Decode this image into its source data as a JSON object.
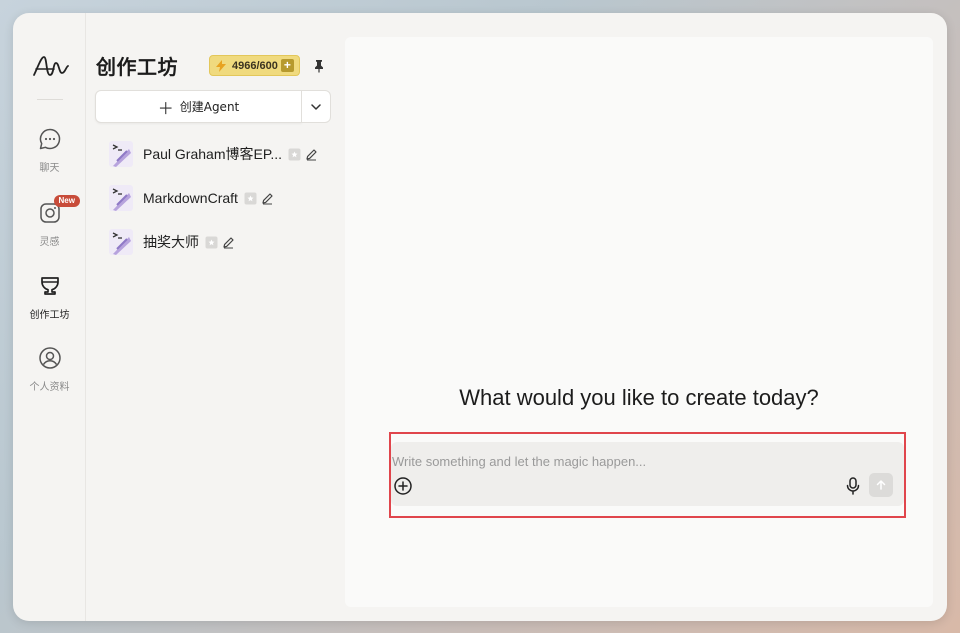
{
  "rail": {
    "items": [
      {
        "label": "聊天",
        "icon": "chat-icon"
      },
      {
        "label": "灵感",
        "icon": "camera-icon",
        "badge": "New"
      },
      {
        "label": "创作工坊",
        "icon": "trophy-icon",
        "active": true
      },
      {
        "label": "个人资料",
        "icon": "user-icon"
      }
    ]
  },
  "sidebar": {
    "title": "创作工坊",
    "credits": "4966/600",
    "create_label": "创建Agent",
    "agents": [
      {
        "name": "Paul Graham博客EP..."
      },
      {
        "name": "MarkdownCraft"
      },
      {
        "name": "抽奖大师"
      }
    ]
  },
  "main": {
    "headline": "What would you like to create today?",
    "input_placeholder": "Write something and let the magic happen...",
    "input_value": ""
  },
  "colors": {
    "highlight_border": "#e0454c",
    "badge": "#c84c3a",
    "credits_bg": "#f0da7e"
  }
}
